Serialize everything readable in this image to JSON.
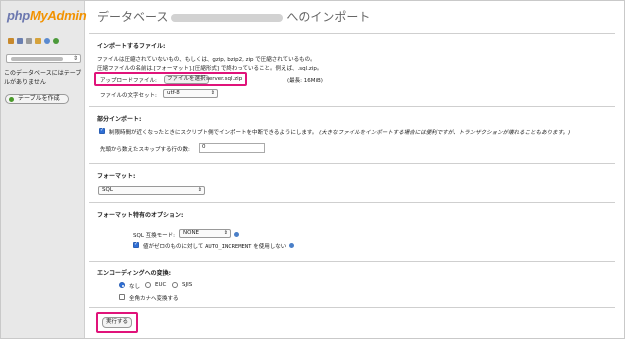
{
  "sidebar": {
    "logo_php": "php",
    "logo_myadmin": "MyAdmin",
    "icons": [
      "home-icon",
      "table-icon",
      "sql-icon",
      "settings-icon",
      "help-icon",
      "reload-icon"
    ],
    "no_tables_text": "このデータベースにはテーブルがありません",
    "create_table_label": "テーブルを作成"
  },
  "header": {
    "title_prefix": "データベース",
    "title_suffix": "へのインポート"
  },
  "file_section": {
    "heading": "インポートするファイル:",
    "desc_line1": "ファイルは圧縮されていないもの、もしくは、gzip, bzip2, zip で圧縮されているもの。",
    "desc_line2": "圧縮ファイルの名前は.[フォーマット].[圧縮形式] で終わっていること。例えば、.sql.zip。",
    "upload_label": "アップロードファイル:",
    "choose_file_label": "ファイルを選択",
    "file_name": "server.sql.zip",
    "max_size": "(最長: 16MiB)",
    "charset_label": "ファイルの文字セット:",
    "charset_value": "utf-8"
  },
  "partial_section": {
    "heading": "部分インポート:",
    "interrupt_label": "制限時間が近くなったときにスクリプト側でインポートを中断できるようにします。",
    "interrupt_note": "(大きなファイルをインポートする場合には便利ですが、トランザクションが壊れることもあります。)",
    "interrupt_checked": true,
    "skip_label": "先頭から数えたスキップする行の数:",
    "skip_value": "0"
  },
  "format_section": {
    "heading": "フォーマット:",
    "format_value": "SQL"
  },
  "options_section": {
    "heading": "フォーマット特有のオプション:",
    "compat_label": "SQL 互換モード:",
    "compat_value": "NONE",
    "auto_inc_label_pre": "値がゼロのものに対して",
    "auto_inc_code": "AUTO_INCREMENT",
    "auto_inc_label_post": "を使用しない",
    "auto_inc_checked": true
  },
  "encoding_section": {
    "heading": "エンコーディングへの変換:",
    "options": [
      "なし",
      "EUC",
      "SJIS"
    ],
    "selected": "なし",
    "kana_label": "全角カナへ変換する",
    "kana_checked": false
  },
  "go_label": "実行する",
  "colors": {
    "highlight": "#e0137a",
    "logo_php": "#6c78af",
    "logo_myadmin": "#f29200"
  }
}
